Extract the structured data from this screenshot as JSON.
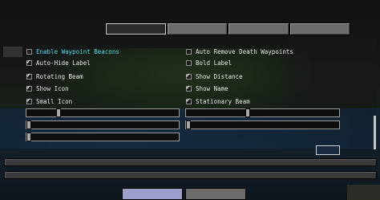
{
  "options": {
    "left": [
      {
        "label": "Enable Waypoint Beacons",
        "checked": false,
        "highlighted": true
      },
      {
        "label": "Auto-Hide Label",
        "checked": true,
        "highlighted": false
      },
      {
        "label": "Rotating Beam",
        "checked": true,
        "highlighted": false
      },
      {
        "label": "Show Icon",
        "checked": true,
        "highlighted": false
      },
      {
        "label": "Small Icon",
        "checked": true,
        "highlighted": false
      }
    ],
    "right": [
      {
        "label": "Auto Remove Death Waypoints",
        "checked": false,
        "highlighted": false
      },
      {
        "label": "Bold Label",
        "checked": false,
        "highlighted": false
      },
      {
        "label": "Show Distance",
        "checked": true,
        "highlighted": false
      },
      {
        "label": "Show Name",
        "checked": true,
        "highlighted": false
      },
      {
        "label": "Stationary Beam",
        "checked": true,
        "highlighted": false
      }
    ]
  },
  "sliders": {
    "left": [
      0.2,
      0.0,
      0.0
    ],
    "right": [
      0.4,
      0.0
    ]
  },
  "check_glyph": "✔"
}
